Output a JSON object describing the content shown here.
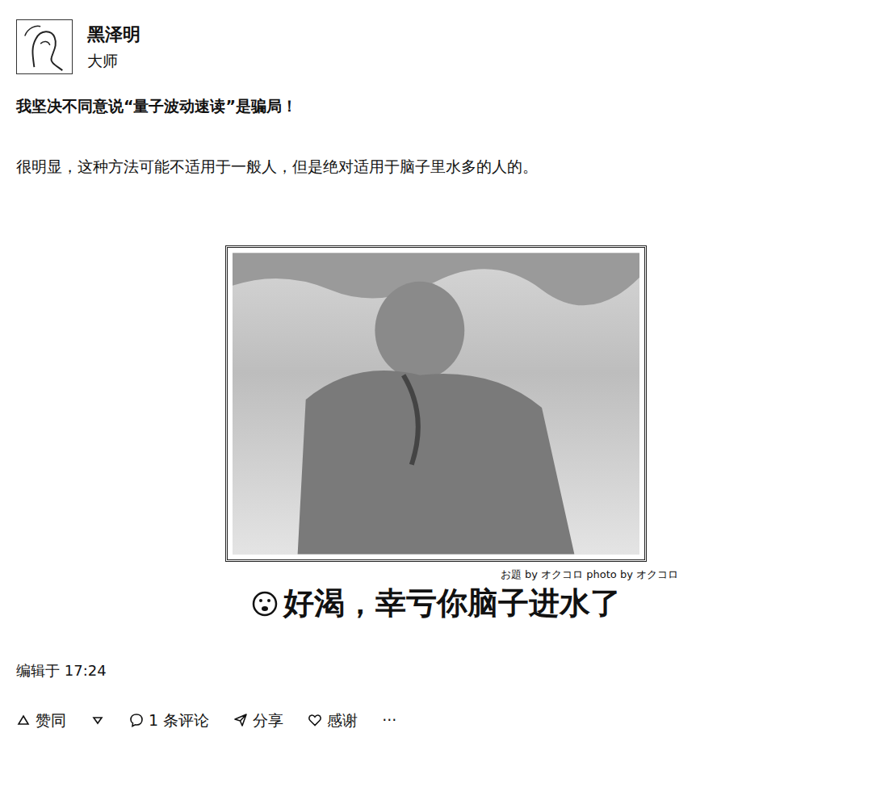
{
  "author": {
    "name": "黑泽明",
    "badge": "大师"
  },
  "post": {
    "title": "我坚决不同意说“量子波动速读”是骗局！",
    "paragraph": "很明显，这种方法可能不适用于一般人，但是绝对适用于脑子里水多的人的。",
    "meme": {
      "credit": "お題 by オクコロ photo by オクコロ",
      "caption": "好渴，幸亏你脑子进水了"
    },
    "edited": "编辑于 17:24"
  },
  "actions": {
    "upvote": "赞同",
    "comments": "1 条评论",
    "share": "分享",
    "thanks": "感谢",
    "more": "···"
  }
}
